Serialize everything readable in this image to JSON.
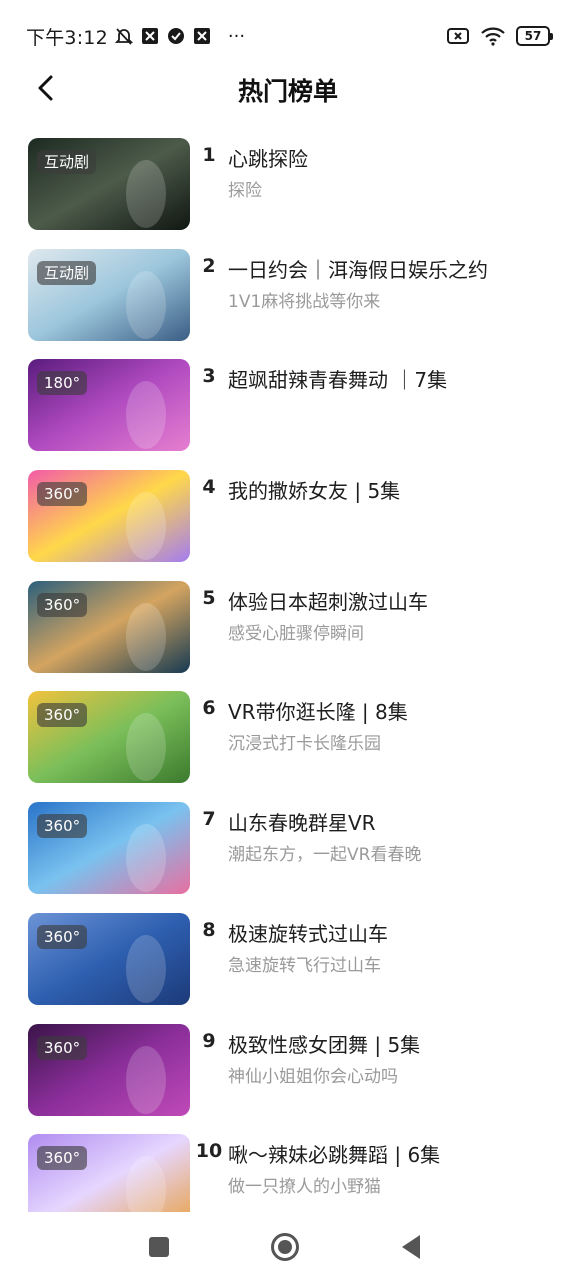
{
  "status": {
    "time": "下午3:12",
    "more": "···",
    "battery": "57"
  },
  "header": {
    "title": "热门榜单"
  },
  "items": [
    {
      "rank": "1",
      "title": "心跳探险",
      "subtitle": "探险",
      "badge": "互动剧",
      "colors": [
        "#1d2a22",
        "#4d5b4a",
        "#101712"
      ]
    },
    {
      "rank": "2",
      "title": "一日约会｜洱海假日娱乐之约",
      "subtitle": "1V1麻将挑战等你来",
      "badge": "互动剧",
      "colors": [
        "#dfe8ee",
        "#9cc6dc",
        "#3a5d84"
      ]
    },
    {
      "rank": "3",
      "title": "超飒甜辣青春舞动 ｜7集",
      "subtitle": "",
      "badge": "180°",
      "colors": [
        "#5a1c7e",
        "#b04ac0",
        "#e67fd0"
      ]
    },
    {
      "rank": "4",
      "title": "我的撒娇女友 | 5集",
      "subtitle": "",
      "badge": "360°",
      "colors": [
        "#f25ba8",
        "#ffd84a",
        "#a37cf0"
      ]
    },
    {
      "rank": "5",
      "title": "体验日本超刺激过山车",
      "subtitle": "感受心脏骤停瞬间",
      "badge": "360°",
      "colors": [
        "#2b5f7c",
        "#d4a460",
        "#163a52"
      ]
    },
    {
      "rank": "6",
      "title": "VR带你逛长隆 | 8集",
      "subtitle": "沉浸式打卡长隆乐园",
      "badge": "360°",
      "colors": [
        "#f1c23d",
        "#7bbf5a",
        "#3b7a2d"
      ]
    },
    {
      "rank": "7",
      "title": "山东春晚群星VR",
      "subtitle": "潮起东方，一起VR看春晚",
      "badge": "360°",
      "colors": [
        "#2a73c9",
        "#79c2ef",
        "#e86fa0"
      ]
    },
    {
      "rank": "8",
      "title": "极速旋转式过山车",
      "subtitle": "急速旋转飞行过山车",
      "badge": "360°",
      "colors": [
        "#6c93d6",
        "#2e5fb0",
        "#1c3a78"
      ]
    },
    {
      "rank": "9",
      "title": "极致性感女团舞 | 5集",
      "subtitle": "神仙小姐姐你会心动吗",
      "badge": "360°",
      "colors": [
        "#3a1448",
        "#8a2e9a",
        "#c04ab8"
      ]
    },
    {
      "rank": "10",
      "title": "啾～辣妹必跳舞蹈 | 6集",
      "subtitle": "做一只撩人的小野猫",
      "badge": "360°",
      "colors": [
        "#b08cf0",
        "#e6d6ff",
        "#e8a24a"
      ]
    }
  ]
}
